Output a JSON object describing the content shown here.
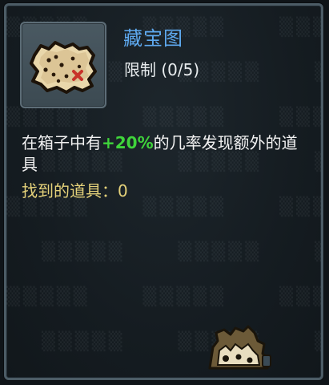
{
  "item": {
    "name": "藏宝图",
    "limit": "限制 (0/5)",
    "icon": "treasure-map-icon"
  },
  "description": {
    "before": "在箱子中有",
    "highlight": "+20%",
    "after": "的几率发现额外的道具"
  },
  "stat": {
    "found_label": "找到的道具：",
    "found_value": "0"
  },
  "colors": {
    "name": "#5ea9ef",
    "highlight": "#3fd43b",
    "stat": "#e5d27a",
    "text": "#f2f2f2"
  }
}
